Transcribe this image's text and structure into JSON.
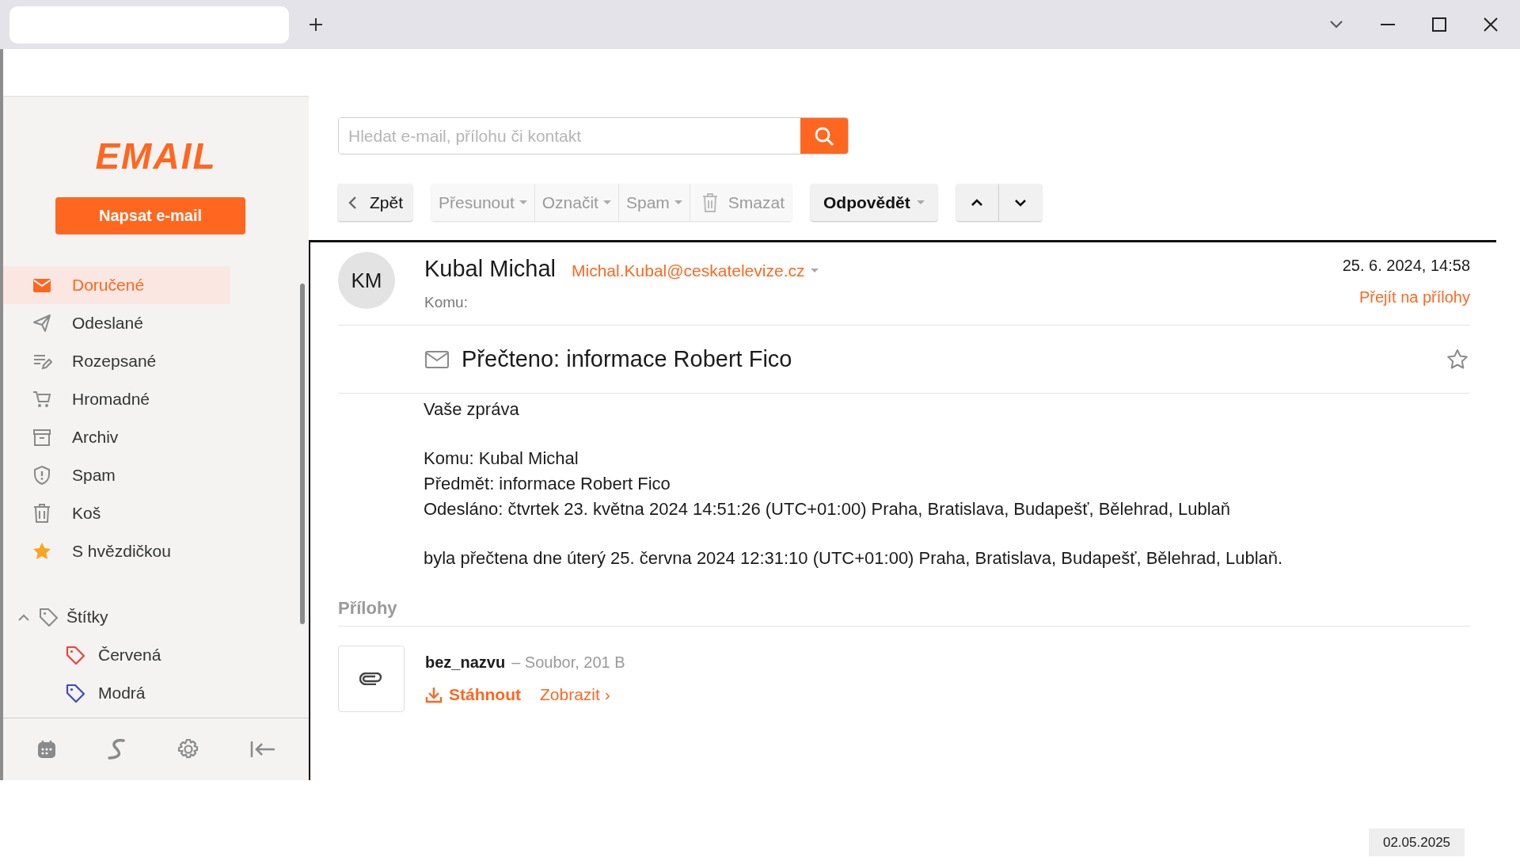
{
  "sidebar": {
    "logo": "EMAIL",
    "compose_button": "Napsat e-mail",
    "folders": [
      {
        "label": "Doručené",
        "selected": true
      },
      {
        "label": "Odeslané",
        "selected": false
      },
      {
        "label": "Rozepsané",
        "selected": false
      },
      {
        "label": "Hromadné",
        "selected": false
      },
      {
        "label": "Archiv",
        "selected": false
      },
      {
        "label": "Spam",
        "selected": false
      },
      {
        "label": "Koš",
        "selected": false
      },
      {
        "label": "S hvězdičkou",
        "selected": false
      }
    ],
    "labels": {
      "label": "Štítky",
      "expanded": true,
      "children": [
        {
          "label": "Červená",
          "color": "#e8453c"
        },
        {
          "label": "Modrá",
          "color": "#3d4bbf"
        }
      ]
    }
  },
  "search": {
    "placeholder": "Hledat e-mail, přílohu či kontakt"
  },
  "toolbar": {
    "back": "Zpět",
    "actions": [
      {
        "label": "Přesunout",
        "disabled": true,
        "dropdown": true
      },
      {
        "label": "Označit",
        "disabled": true,
        "dropdown": true
      },
      {
        "label": "Spam",
        "disabled": true,
        "dropdown": true
      },
      {
        "label": "Smazat",
        "disabled": true,
        "dropdown": false
      }
    ],
    "reply": "Odpovědět"
  },
  "message": {
    "avatar": "KM",
    "sender_name": "Kubal Michal",
    "sender_email": "Michal.Kubal@ceskatelevize.cz",
    "to_label": "Komu:",
    "date": "25. 6. 2024, 14:58",
    "attachments_link": "Přejít na přílohy",
    "subject": "Přečteno: informace Robert Fico",
    "starred": false,
    "body": [
      [
        "Vaše zpráva"
      ],
      [
        "Komu: Kubal Michal",
        "Předmět: informace Robert Fico",
        "Odesláno: čtvrtek 23. května 2024 14:51:26 (UTC+01:00) Praha, Bratislava, Budapešť, Bělehrad, Lublaň"
      ],
      [
        "byla přečtena dne úterý 25. června 2024 12:31:10 (UTC+01:00) Praha, Bratislava, Budapešť, Bělehrad, Lublaň."
      ]
    ]
  },
  "attachments": {
    "heading": "Přílohy",
    "items": [
      {
        "name": "bez_nazvu",
        "meta": "– Soubor, 201 B",
        "download": "Stáhnout",
        "view": "Zobrazit ›"
      }
    ]
  },
  "date_stamp": "02.05.2025"
}
